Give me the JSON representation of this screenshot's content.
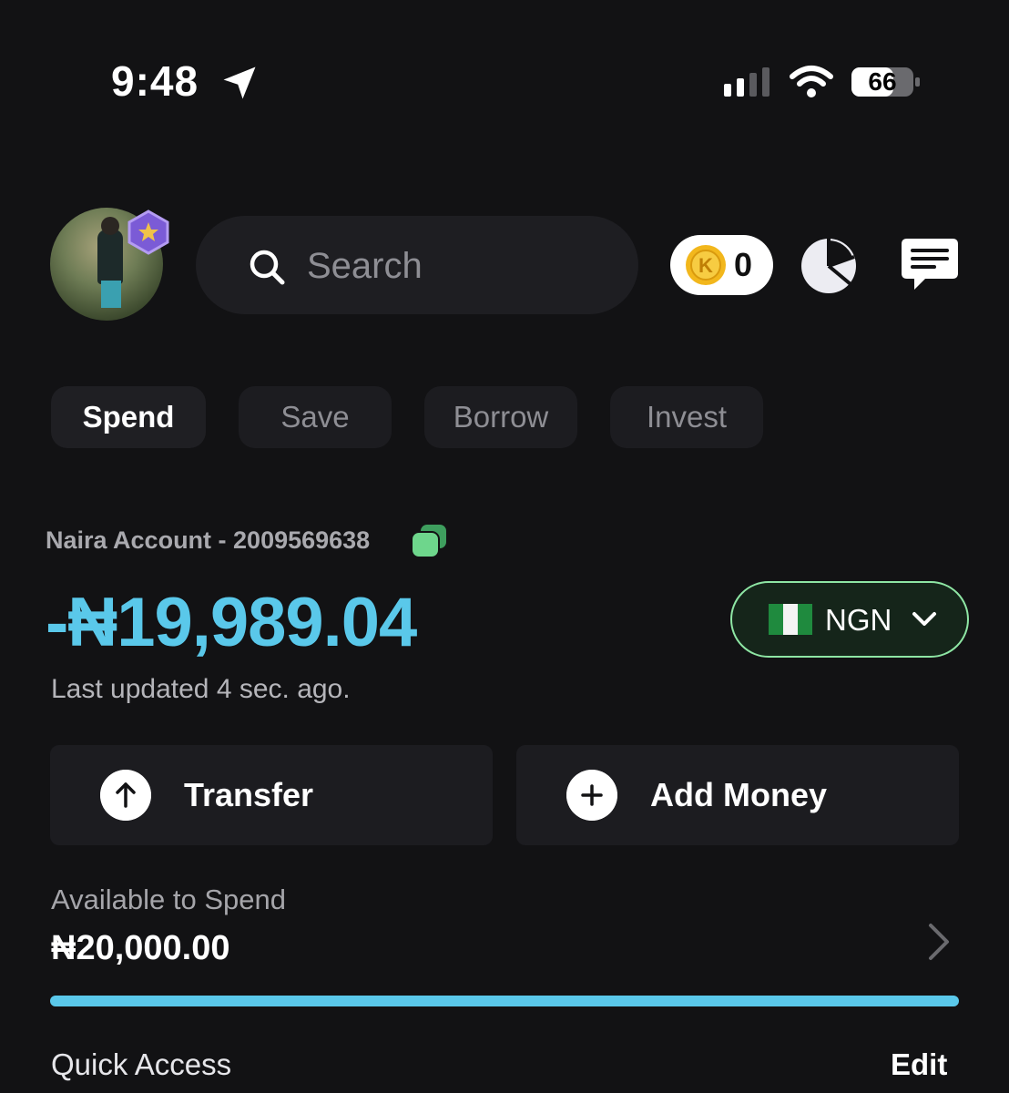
{
  "status_bar": {
    "time": "9:48",
    "battery": "66"
  },
  "header": {
    "search_placeholder": "Search",
    "coins": "0"
  },
  "tabs": [
    {
      "label": "Spend",
      "active": true
    },
    {
      "label": "Save",
      "active": false
    },
    {
      "label": "Borrow",
      "active": false
    },
    {
      "label": "Invest",
      "active": false
    }
  ],
  "account": {
    "label": "Naira Account - 2009569638",
    "balance": "-₦19,989.04",
    "currency": "NGN",
    "last_updated": "Last updated 4 sec. ago."
  },
  "actions": {
    "transfer": "Transfer",
    "add_money": "Add Money"
  },
  "available": {
    "label": "Available to Spend",
    "amount": "₦20,000.00",
    "progress_fraction": 1.0
  },
  "quick_access": {
    "title": "Quick Access",
    "edit": "Edit"
  },
  "colors": {
    "accent_blue": "#5ac8ea",
    "accent_green": "#8ee6a4",
    "background": "#121214"
  }
}
